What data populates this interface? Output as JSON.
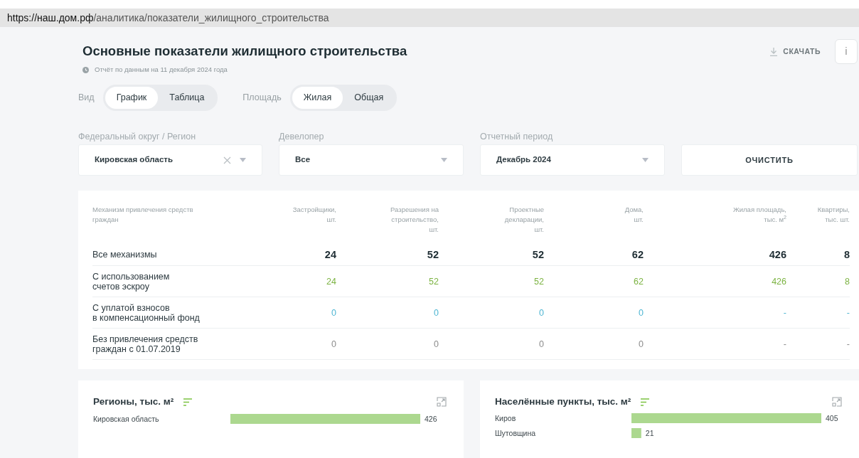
{
  "address_bar": {
    "host": "https://наш.дом.рф",
    "path": "/аналитика/показатели_жилищного_строительства"
  },
  "header": {
    "title": "Основные показатели жилищного строительства",
    "report_date": "Отчёт по данным на 11 декабря 2024 года",
    "download": "СКАЧАТЬ",
    "info": "i"
  },
  "toggles": [
    {
      "label": "Вид",
      "options": [
        {
          "label": "График",
          "selected": true
        },
        {
          "label": "Таблица",
          "selected": false
        }
      ]
    },
    {
      "label": "Площадь",
      "options": [
        {
          "label": "Жилая",
          "selected": true
        },
        {
          "label": "Общая",
          "selected": false
        }
      ]
    }
  ],
  "filters": [
    {
      "label": "Федеральный округ / Регион",
      "value": "Кировская область",
      "clearable": true
    },
    {
      "label": "Девелопер",
      "value": "Все",
      "clearable": false
    },
    {
      "label": "Отчетный период",
      "value": "Декабрь 2024",
      "clearable": false
    }
  ],
  "clear_button": "ОЧИСТИТЬ",
  "table": {
    "columns": [
      "Механизм привлечения средств\nграждан",
      "Застройщики,\nшт.",
      "Разрешения на\nстроительство,\nшт.",
      "Проектные\nдекларации,\nшт.",
      "Дома,\nшт.",
      "Жилая площадь,\nтыс. м$^{2}$",
      "Квартиры,\nтыс. шт."
    ],
    "rows": [
      {
        "kind": "total",
        "label": "Все механизмы",
        "values": [
          "24",
          "52",
          "52",
          "62",
          "426",
          "8"
        ]
      },
      {
        "kind": "escrow",
        "label": "С использованием\nсчетов эскроу",
        "values": [
          "24",
          "52",
          "52",
          "62",
          "426",
          "8"
        ]
      },
      {
        "kind": "fund",
        "label": "С уплатой взносов\nв компенсационный фонд",
        "values": [
          "0",
          "0",
          "0",
          "0",
          "-",
          "-"
        ]
      },
      {
        "kind": "none",
        "label": "Без привлечения средств\nграждан с 01.07.2019",
        "values": [
          "0",
          "0",
          "0",
          "0",
          "-",
          "-"
        ]
      }
    ]
  },
  "charts": [
    {
      "title": "Регионы, тыс. м²",
      "chart_data": {
        "type": "bar",
        "orientation": "horizontal",
        "categories": [
          "Кировская область"
        ],
        "values": [
          426
        ],
        "data_labels": true
      }
    },
    {
      "title": "Населённые пункты, тыс. м²",
      "chart_data": {
        "type": "bar",
        "orientation": "horizontal",
        "categories": [
          "Киров",
          "Шутовщина"
        ],
        "values": [
          405,
          21
        ],
        "data_labels": true
      }
    }
  ]
}
